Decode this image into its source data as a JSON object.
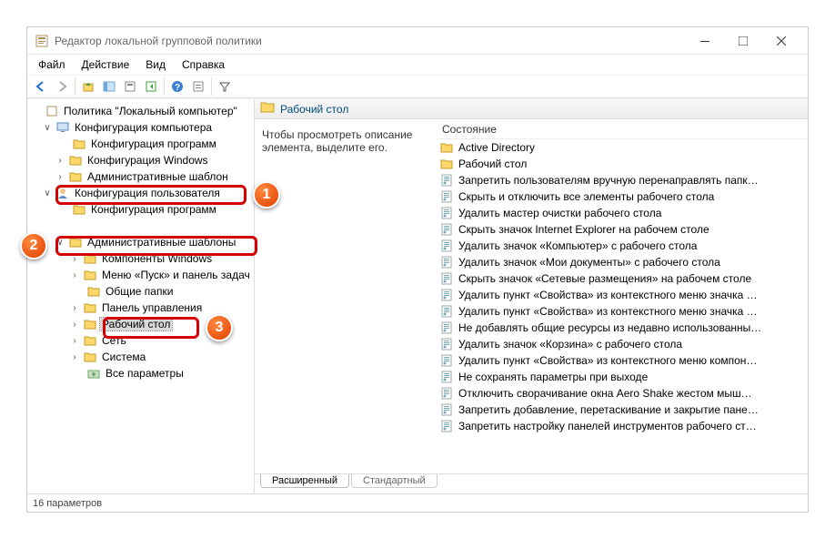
{
  "window": {
    "title": "Редактор локальной групповой политики"
  },
  "menu": {
    "file": "Файл",
    "action": "Действие",
    "view": "Вид",
    "help": "Справка"
  },
  "tree": {
    "root": "Политика \"Локальный компьютер\"",
    "comp_config": "Конфигурация компьютера",
    "comp_software": "Конфигурация программ",
    "comp_windows": "Конфигурация Windows",
    "comp_admin": "Административные шаблон",
    "user_config": "Конфигурация пользователя",
    "user_software": "Конфигурация программ",
    "user_admin": "Административные шаблоны",
    "win_components": "Компоненты Windows",
    "start_taskbar": "Меню «Пуск» и панель задач",
    "shared_folders": "Общие папки",
    "control_panel": "Панель управления",
    "desktop": "Рабочий стол",
    "network": "Сеть",
    "system": "Система",
    "all_settings": "Все параметры"
  },
  "pane": {
    "title": "Рабочий стол",
    "description": "Чтобы просмотреть описание элемента, выделите его.",
    "column_header": "Состояние",
    "items": [
      "Active Directory",
      "Рабочий стол",
      "Запретить пользователям вручную перенаправлять папк…",
      "Скрыть и отключить все элементы рабочего стола",
      "Удалить мастер очистки рабочего стола",
      "Скрыть значок Internet Explorer на рабочем столе",
      "Удалить значок «Компьютер» с рабочего стола",
      "Удалить значок «Мои документы» с рабочего стола",
      "Скрыть значок «Сетевые размещения» на рабочем столе",
      "Удалить пункт «Свойства» из контекстного меню значка …",
      "Удалить пункт «Свойства» из контекстного меню значка …",
      "Не добавлять общие ресурсы из недавно использованны…",
      "Удалить значок «Корзина» с рабочего стола",
      "Удалить пункт «Свойства» из контекстного меню компон…",
      "Не сохранять параметры при выходе",
      "Отключить сворачивание окна Aero Shake жестом мыш…",
      "Запретить добавление, перетаскивание и закрытие пане…",
      "Запретить настройку панелей инструментов рабочего ст…"
    ]
  },
  "tabs": {
    "extended": "Расширенный",
    "standard": "Стандартный"
  },
  "status": "16 параметров"
}
